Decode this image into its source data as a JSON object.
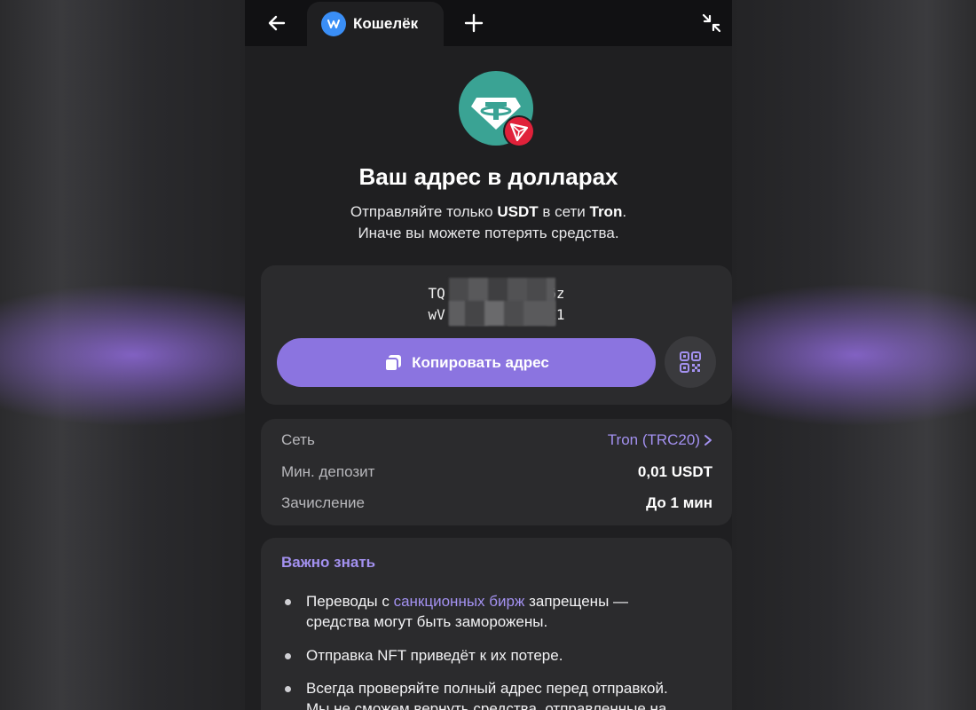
{
  "tab": {
    "label": "Кошелёк"
  },
  "header": {
    "title": "Ваш адрес в долларах",
    "subtitle_line1_pre": "Отправляйте только ",
    "subtitle_token": "USDT",
    "subtitle_mid": " в сети ",
    "subtitle_network": "Tron",
    "subtitle_end": ".",
    "subtitle_line2": "Иначе вы можете потерять средства."
  },
  "address": {
    "line1": "TQ            6z",
    "line2": "wV            C1"
  },
  "actions": {
    "copy_label": "Копировать адрес"
  },
  "details": {
    "network_label": "Сеть",
    "network_value": "Tron (TRC20)",
    "min_deposit_label": "Мин. депозит",
    "min_deposit_value": "0,01 USDT",
    "credit_label": "Зачисление",
    "credit_value": "До 1 мин"
  },
  "notice": {
    "title": "Важно знать",
    "b1_pre": "Переводы с ",
    "b1_link": "санкционных бирж",
    "b1_post": " запрещены —",
    "b1_line2": "средства могут быть заморожены.",
    "b2": "Отправка NFT приведёт к их потере.",
    "b3_line1": "Всегда проверяйте полный адрес перед отправкой.",
    "b3_line2": "Мы не сможем вернуть средства, отправленные на"
  },
  "colors": {
    "accent": "#8b74e0",
    "link": "#a391f0",
    "tether": "#3aa394",
    "tron": "#e0213a",
    "telegram": "#3a8ef6"
  },
  "icons": [
    "back-arrow-icon",
    "wallet-app-icon",
    "plus-icon",
    "collapse-icon",
    "tether-icon",
    "tron-icon",
    "copy-icon",
    "qr-code-icon",
    "chevron-right-icon"
  ]
}
